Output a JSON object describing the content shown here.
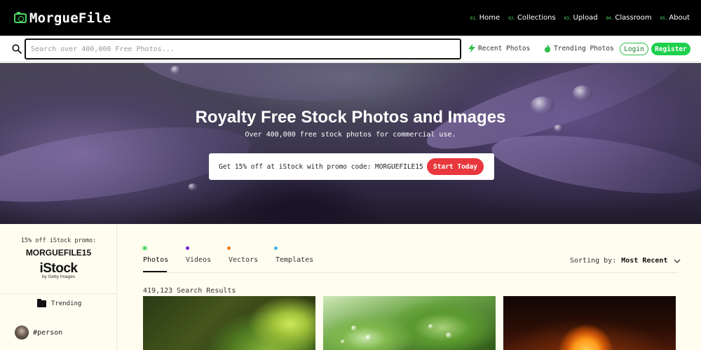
{
  "brand": {
    "name": "MorgueFile",
    "accent": "#4cd964"
  },
  "nav": [
    {
      "num": "01.",
      "label": "Home"
    },
    {
      "num": "02.",
      "label": "Collections"
    },
    {
      "num": "03.",
      "label": "Upload"
    },
    {
      "num": "04.",
      "label": "Classroom"
    },
    {
      "num": "05.",
      "label": "About"
    }
  ],
  "search": {
    "placeholder": "Search over 400,000 Free Photos...",
    "value": ""
  },
  "quick_links": {
    "recent": "Recent Photos",
    "trending": "Trending Photos"
  },
  "auth": {
    "login": "Login",
    "register": "Register"
  },
  "hero": {
    "title": "Royalty Free Stock Photos and Images",
    "subtitle": "Over 400,000 free stock photos for commercial use.",
    "promo_text": "Get 15% off at iStock with promo code: MORGUEFILE15",
    "promo_button": "Start Today"
  },
  "sidebar": {
    "promo_label": "15% off iStock promo:",
    "promo_code": "MORGUEFILE15",
    "istock_logo": "iStock",
    "istock_sub": "by Getty Images",
    "trending_label": "Trending",
    "tags": [
      "#person"
    ]
  },
  "tabs": [
    {
      "label": "Photos",
      "dot_color": "#4cd964",
      "active": true
    },
    {
      "label": "Videos",
      "dot_color": "#7a1fd6",
      "active": false
    },
    {
      "label": "Vectors",
      "dot_color": "#f07a1a",
      "active": false
    },
    {
      "label": "Templates",
      "dot_color": "#3fb8e8",
      "active": false
    }
  ],
  "sort": {
    "label": "Sorting by:",
    "value": "Most Recent"
  },
  "results": {
    "text": "419,123 Search Results"
  },
  "colors": {
    "register": "#1ed04b",
    "promo_button": "#e8383d",
    "page_bg": "#fffdf0"
  }
}
